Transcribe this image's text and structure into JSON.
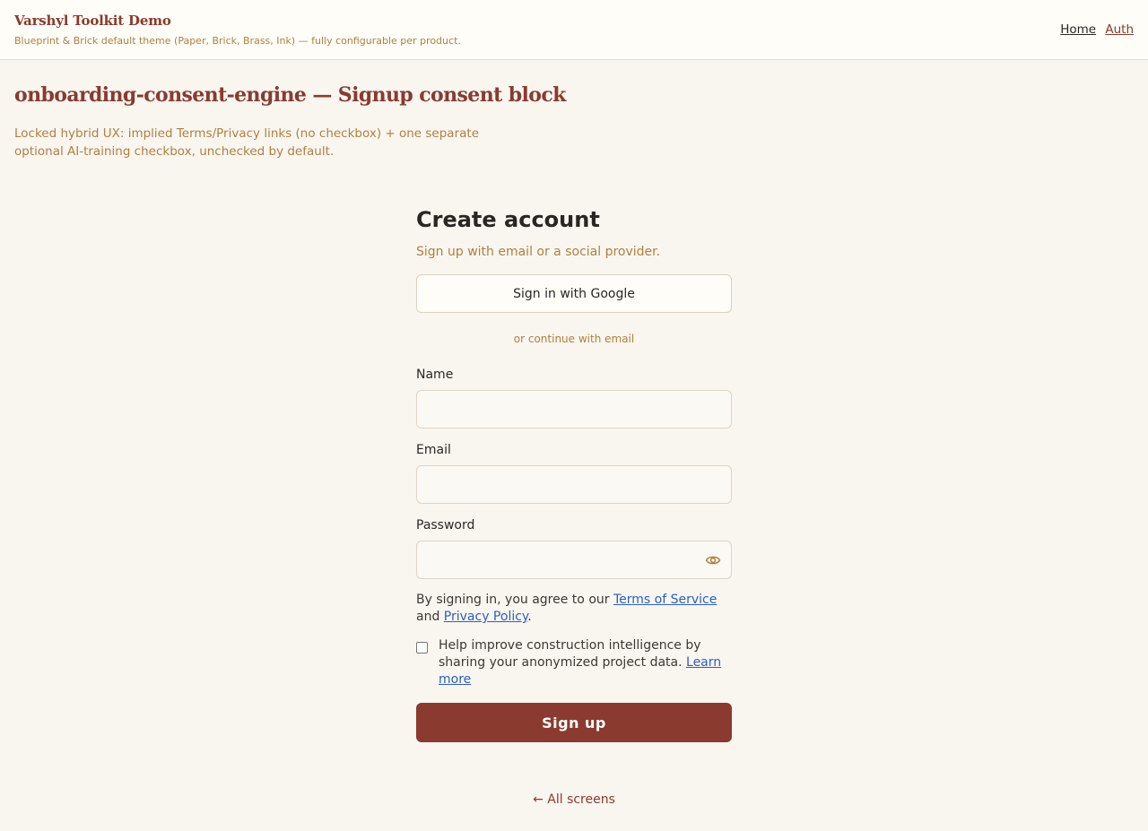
{
  "header": {
    "title": "Varshyl Toolkit Demo",
    "subtitle": "Blueprint & Brick default theme (Paper, Brick, Brass, Ink) — fully configurable per product.",
    "nav": {
      "home": "Home",
      "auth": "Auth"
    }
  },
  "page": {
    "title": "onboarding-consent-engine — Signup consent block",
    "description": "Locked hybrid UX: implied Terms/Privacy links (no checkbox) + one separate optional AI-training checkbox, unchecked by default."
  },
  "form": {
    "title": "Create account",
    "subtitle": "Sign up with email or a social provider.",
    "google_button": "Sign in with Google",
    "divider": "or continue with email",
    "name_label": "Name",
    "name_value": "",
    "email_label": "Email",
    "email_value": "",
    "password_label": "Password",
    "password_value": "",
    "terms_prefix": "By signing in, you agree to our ",
    "terms_link": "Terms of Service",
    "terms_middle": " and ",
    "privacy_link": "Privacy Policy",
    "terms_suffix": ".",
    "consent_text": "Help improve construction intelligence by sharing your anonymized project data. ",
    "consent_link": "Learn more",
    "consent_checked": false,
    "submit_button": "Sign up"
  },
  "footer": {
    "back_link": "← All screens"
  },
  "colors": {
    "brick": "#8a3a2e",
    "brass": "#b0803f",
    "paper": "#f9f6f0",
    "ink": "#2a2623",
    "link": "#2b5fc4"
  },
  "icons": {
    "password_toggle": "eye-icon"
  }
}
